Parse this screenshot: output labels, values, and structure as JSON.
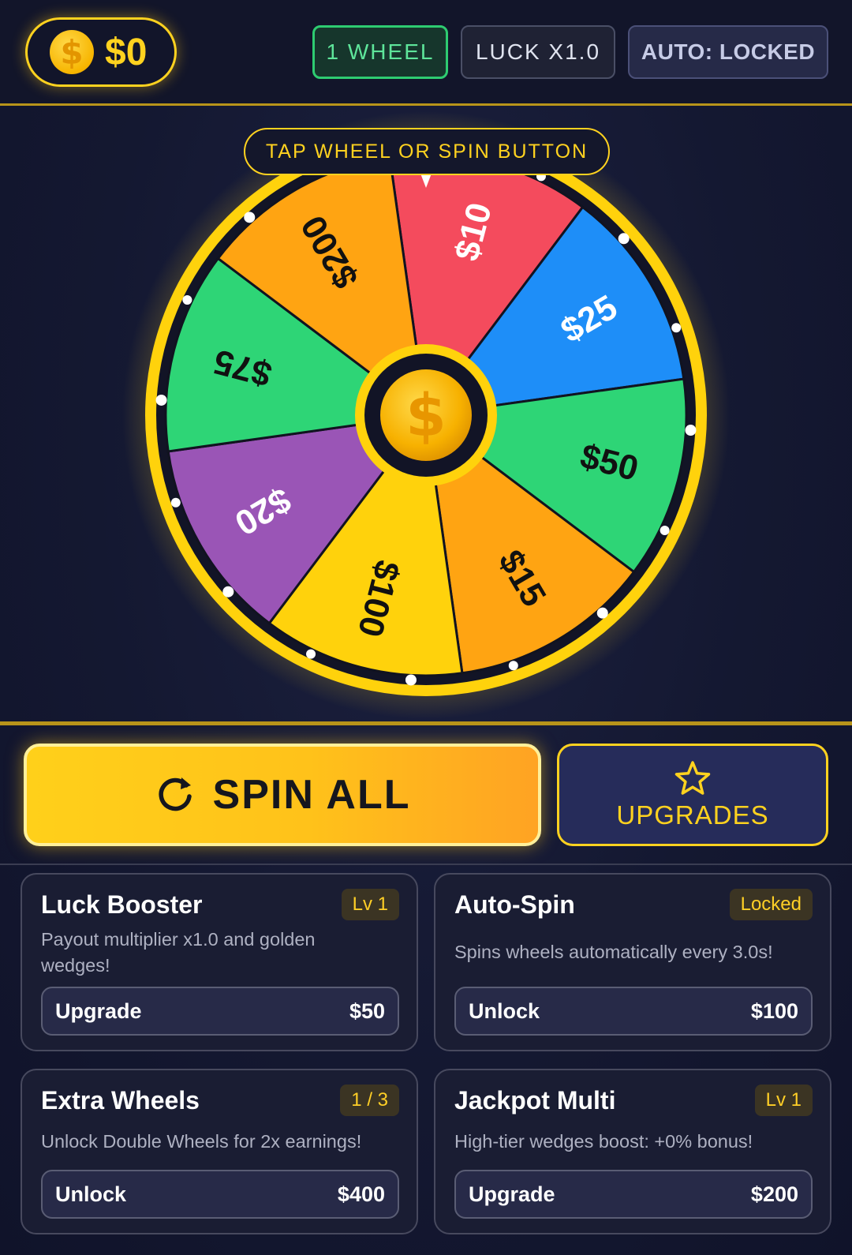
{
  "header": {
    "balance": "$0",
    "coin_icon": "dollar-coin-icon",
    "wheel_count_label": "1 WHEEL",
    "luck_label": "LUCK X1.0",
    "auto_label": "AUTO: LOCKED"
  },
  "wheel": {
    "hint": "TAP WHEEL OR SPIN BUTTON",
    "center_icon": "dollar-coin-icon",
    "segments": [
      {
        "label": "$10",
        "color": "#f44b5d",
        "text_color": "#ffffff"
      },
      {
        "label": "$25",
        "color": "#1e8ef8",
        "text_color": "#ffffff"
      },
      {
        "label": "$50",
        "color": "#2ed576",
        "text_color": "#111111"
      },
      {
        "label": "$15",
        "color": "#ffa412",
        "text_color": "#111111"
      },
      {
        "label": "$100",
        "color": "#ffd20c",
        "text_color": "#111111"
      },
      {
        "label": "$20",
        "color": "#9a55b6",
        "text_color": "#ffffff"
      },
      {
        "label": "$75",
        "color": "#2ed576",
        "text_color": "#111111"
      },
      {
        "label": "$200",
        "color": "#ffa412",
        "text_color": "#111111"
      }
    ]
  },
  "actions": {
    "spin_label": "SPIN ALL",
    "spin_icon": "refresh-icon",
    "upgrades_label": "UPGRADES",
    "upgrades_icon": "star-icon"
  },
  "cards": [
    {
      "title": "Luck Booster",
      "badge": "Lv 1",
      "desc": "Payout multiplier x1.0 and golden wedges!",
      "action": "Upgrade",
      "price": "$50"
    },
    {
      "title": "Auto-Spin",
      "badge": "Locked",
      "desc": "Spins wheels automatically every 3.0s!",
      "action": "Unlock",
      "price": "$100"
    },
    {
      "title": "Extra Wheels",
      "badge": "1 / 3",
      "desc": "Unlock Double Wheels for 2x earnings!",
      "action": "Unlock",
      "price": "$400"
    },
    {
      "title": "Jackpot Multi",
      "badge": "Lv 1",
      "desc": "High-tier wedges boost: +0% bonus!",
      "action": "Upgrade",
      "price": "$200"
    }
  ],
  "colors": {
    "accent": "#ffd21f",
    "background": "#141831",
    "card_bg": "#1a1d33",
    "green": "#2ecc71"
  }
}
